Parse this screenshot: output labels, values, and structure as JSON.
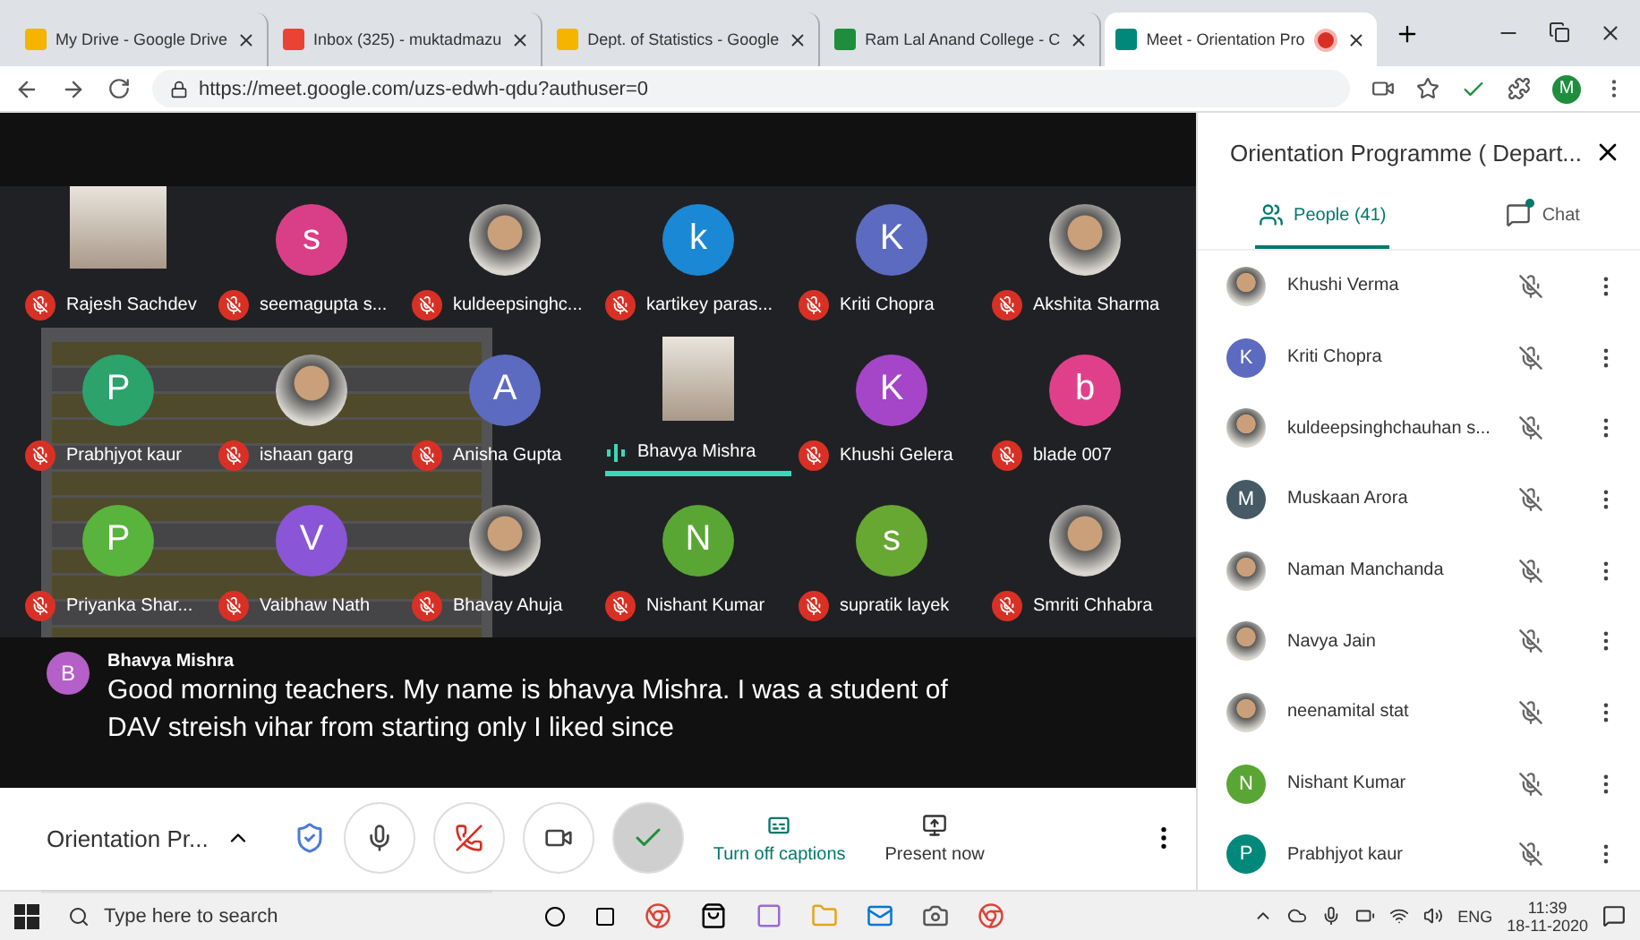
{
  "browser": {
    "tabs": [
      {
        "title": "My Drive - Google Drive",
        "selected": false,
        "recording": false
      },
      {
        "title": "Inbox (325) - muktadmazu",
        "selected": false,
        "recording": false
      },
      {
        "title": "Dept. of Statistics - Google",
        "selected": false,
        "recording": false
      },
      {
        "title": "Ram Lal Anand College - C",
        "selected": false,
        "recording": false
      },
      {
        "title": "Meet - Orientation Pro",
        "selected": true,
        "recording": true
      }
    ],
    "url": "https://meet.google.com/uzs-edwh-qdu?authuser=0",
    "profile": "M"
  },
  "tiles": [
    {
      "name": "Rajesh Sachdev",
      "kind": "video",
      "muted": true,
      "speaking": false
    },
    {
      "name": "seemagupta s...",
      "kind": "letter",
      "letter": "s",
      "color": "#d93f87",
      "muted": true,
      "speaking": false
    },
    {
      "name": "kuldeepsinghc...",
      "kind": "photo",
      "muted": true,
      "speaking": false
    },
    {
      "name": "kartikey paras...",
      "kind": "letter",
      "letter": "k",
      "color": "#1a88d4",
      "muted": true,
      "speaking": false
    },
    {
      "name": "Kriti Chopra",
      "kind": "letter",
      "letter": "K",
      "color": "#5c6bc0",
      "muted": true,
      "speaking": false
    },
    {
      "name": "Akshita Sharma",
      "kind": "photo",
      "muted": true,
      "speaking": false
    },
    {
      "name": "Prabhjyot kaur",
      "kind": "letter",
      "letter": "P",
      "color": "#2ba36b",
      "muted": true,
      "speaking": false
    },
    {
      "name": "ishaan garg",
      "kind": "photo",
      "muted": true,
      "speaking": false
    },
    {
      "name": "Anisha Gupta",
      "kind": "letter",
      "letter": "A",
      "color": "#5c6bc0",
      "muted": true,
      "speaking": false
    },
    {
      "name": "Bhavya Mishra",
      "kind": "video",
      "muted": false,
      "speaking": true
    },
    {
      "name": "Khushi Gelera",
      "kind": "letter",
      "letter": "K",
      "color": "#a545c8",
      "muted": true,
      "speaking": false
    },
    {
      "name": "blade 007",
      "kind": "letter",
      "letter": "b",
      "color": "#e0408a",
      "muted": true,
      "speaking": false
    },
    {
      "name": "Priyanka Shar...",
      "kind": "letter",
      "letter": "P",
      "color": "#58b43c",
      "muted": true,
      "speaking": false
    },
    {
      "name": "Vaibhaw Nath",
      "kind": "letter",
      "letter": "V",
      "color": "#8a55d6",
      "muted": true,
      "speaking": false
    },
    {
      "name": "Bhavay Ahuja",
      "kind": "photo",
      "muted": true,
      "speaking": false
    },
    {
      "name": "Nishant Kumar",
      "kind": "letter",
      "letter": "N",
      "color": "#5aa634",
      "muted": true,
      "speaking": false
    },
    {
      "name": "supratik layek",
      "kind": "letter",
      "letter": "s",
      "color": "#66a832",
      "muted": true,
      "speaking": false
    },
    {
      "name": "Smriti Chhabra",
      "kind": "photo",
      "muted": true,
      "speaking": false
    }
  ],
  "caption": {
    "speaker": "Bhavya Mishra",
    "letter": "B",
    "color": "#b55fc8",
    "text": "Good morning teachers. My name is bhavya Mishra. I was a student of DAV streish vihar from starting only I liked since"
  },
  "controls": {
    "meeting": "Orientation Pr...",
    "captions": "Turn off captions",
    "present": "Present now",
    "captions_on": true
  },
  "panel": {
    "title": "Orientation Programme ( Depart...",
    "tabs": [
      {
        "label": "People (41)",
        "kind": "people",
        "selected": true
      },
      {
        "label": "Chat",
        "kind": "chat",
        "selected": false,
        "unread": true
      }
    ],
    "people": [
      {
        "name": "Khushi Verma",
        "kind": "photo"
      },
      {
        "name": "Kriti Chopra",
        "kind": "letter",
        "letter": "K",
        "color": "#5c6bc0"
      },
      {
        "name": "kuldeepsinghchauhan s...",
        "kind": "photo"
      },
      {
        "name": "Muskaan Arora",
        "kind": "letter",
        "letter": "M",
        "color": "#455a64"
      },
      {
        "name": "Naman Manchanda",
        "kind": "photo"
      },
      {
        "name": "Navya Jain",
        "kind": "photo"
      },
      {
        "name": "neenamital stat",
        "kind": "photo"
      },
      {
        "name": "Nishant Kumar",
        "kind": "letter",
        "letter": "N",
        "color": "#5aa634"
      },
      {
        "name": "Prabhjyot kaur",
        "kind": "letter",
        "letter": "P",
        "color": "#00897b"
      }
    ]
  },
  "taskbar": {
    "search_placeholder": "Type here to search",
    "language": "ENG",
    "time": "11:39",
    "date": "18-11-2020"
  }
}
